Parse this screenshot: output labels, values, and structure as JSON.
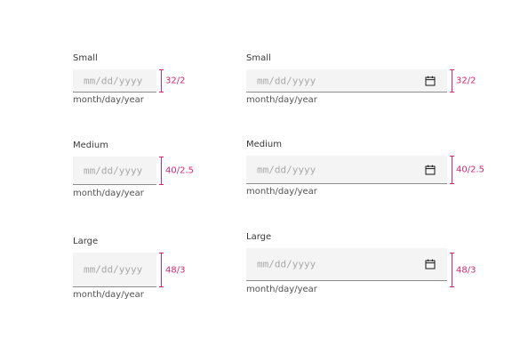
{
  "accent_color": "#d12771",
  "left_column": [
    {
      "label": "Small",
      "placeholder": "mm/dd/yyyy",
      "helper": "month/day/year",
      "spec": "32/2"
    },
    {
      "label": "Medium",
      "placeholder": "mm/dd/yyyy",
      "helper": "month/day/year",
      "spec": "40/2.5"
    },
    {
      "label": "Large",
      "placeholder": "mm/dd/yyyy",
      "helper": "month/day/year",
      "spec": "48/3"
    }
  ],
  "right_column": [
    {
      "label": "Small",
      "placeholder": "mm/dd/yyyy",
      "helper": "month/day/year",
      "spec": "32/2",
      "icon": "calendar-icon"
    },
    {
      "label": "Medium",
      "placeholder": "mm/dd/yyyy",
      "helper": "month/day/year",
      "spec": "40/2.5",
      "icon": "calendar-icon"
    },
    {
      "label": "Large",
      "placeholder": "mm/dd/yyyy",
      "helper": "month/day/year",
      "spec": "48/3",
      "icon": "calendar-icon"
    }
  ]
}
